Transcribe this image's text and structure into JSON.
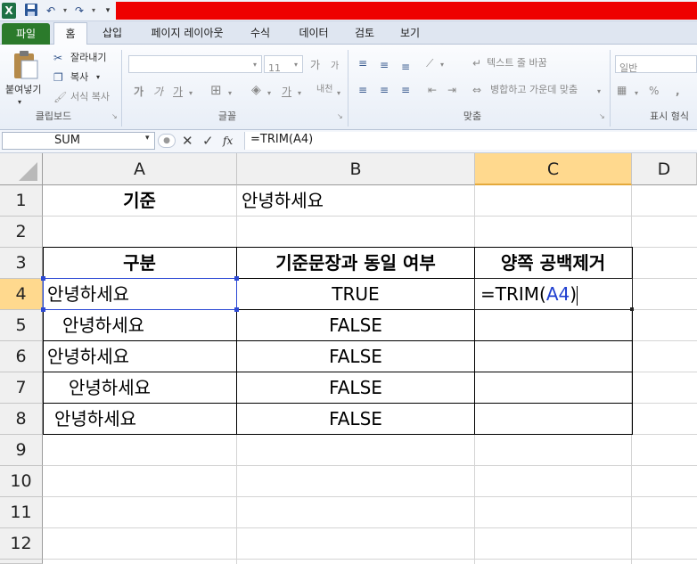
{
  "title_bar": {
    "quick_access_icons": [
      "excel-logo-icon",
      "save-icon",
      "undo-icon",
      "redo-icon",
      "customize-qat-icon"
    ],
    "logo_letter": "X"
  },
  "ribbon": {
    "tabs": [
      "파일",
      "홈",
      "삽입",
      "페이지 레이아웃",
      "수식",
      "데이터",
      "검토",
      "보기"
    ],
    "clipboard": {
      "paste": "붙여넣기",
      "cut": "잘라내기",
      "copy": "복사",
      "format_painter": "서식 복사",
      "group": "클립보드"
    },
    "font": {
      "name": "",
      "size": "11",
      "grow": "가",
      "shrink": "가",
      "bold": "가",
      "italic": "가",
      "underline": "가",
      "phonetic": "내천",
      "font_color": "가",
      "group": "글꼴"
    },
    "alignment": {
      "wrap_text": "텍스트 줄 바꿈",
      "merge_center": "병합하고 가운데 맞춤",
      "group": "맞춤"
    },
    "number": {
      "format": "일반",
      "percent": "%",
      "comma": ",",
      "group": "표시 형식"
    }
  },
  "formula_bar": {
    "name_box": "SUM",
    "fx": "fx",
    "formula": "=TRIM(A4)"
  },
  "sheet": {
    "columns": [
      "A",
      "B",
      "C",
      "D"
    ],
    "rows": [
      "1",
      "2",
      "3",
      "4",
      "5",
      "6",
      "7",
      "8",
      "9",
      "10",
      "11",
      "12"
    ],
    "A1": "기준",
    "B1": "안녕하세요",
    "headers": [
      "구분",
      "기준문장과 동일 여부",
      "양쪽 공백제거"
    ],
    "data": [
      {
        "a": "안녕하세요",
        "b": "TRUE"
      },
      {
        "a": "  안녕하세요",
        "b": "FALSE"
      },
      {
        "a": "안녕하세요",
        "b": "FALSE"
      },
      {
        "a": "   안녕하세요",
        "b": "FALSE"
      },
      {
        "a": " 안녕하세요",
        "b": "FALSE"
      }
    ],
    "edit": {
      "prefix": "=TRIM(",
      "ref": "A4",
      "suffix": ")"
    },
    "colors": {
      "ref_blue": "#1f3fcf",
      "active_col_header": "#ffd98e"
    }
  }
}
